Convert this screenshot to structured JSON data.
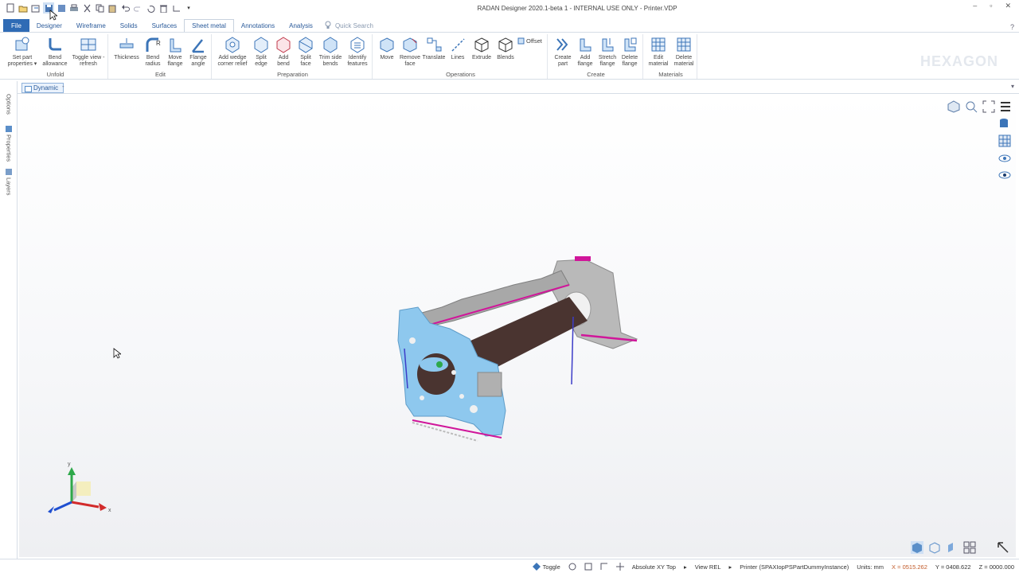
{
  "window": {
    "title": "RADAN Designer 2020.1-beta 1 - INTERNAL USE ONLY - Printer.VDP",
    "logo_text": "HEXAGON"
  },
  "tabs": [
    {
      "label": "File"
    },
    {
      "label": "Designer"
    },
    {
      "label": "Wireframe"
    },
    {
      "label": "Solids"
    },
    {
      "label": "Surfaces"
    },
    {
      "label": "Sheet metal"
    },
    {
      "label": "Annotations"
    },
    {
      "label": "Analysis"
    }
  ],
  "quick_search": {
    "label": "Quick Search"
  },
  "ribbon": {
    "unfold": {
      "label": "Unfold",
      "buttons": [
        {
          "label": "Set part properties ▾"
        },
        {
          "label": "Bend allowance"
        },
        {
          "label": "Toggle view - refresh"
        }
      ]
    },
    "edit": {
      "label": "Edit",
      "buttons": [
        {
          "label": "Thickness"
        },
        {
          "label": "Bend radius"
        },
        {
          "label": "Move flange"
        },
        {
          "label": "Flange angle"
        }
      ]
    },
    "preparation": {
      "label": "Preparation",
      "buttons": [
        {
          "label": "Add wedge corner relief"
        },
        {
          "label": "Split edge"
        },
        {
          "label": "Add bend"
        },
        {
          "label": "Split face"
        },
        {
          "label": "Trim side bends"
        },
        {
          "label": "Identify features"
        }
      ]
    },
    "operations": {
      "label": "Operations",
      "buttons": [
        {
          "label": "Move"
        },
        {
          "label": "Remove face"
        },
        {
          "label": "Translate"
        },
        {
          "label": "Lines"
        },
        {
          "label": "Extrude"
        },
        {
          "label": "Blends"
        }
      ],
      "offset_label": "Offset"
    },
    "create": {
      "label": "Create",
      "buttons": [
        {
          "label": "Create part"
        },
        {
          "label": "Add flange"
        },
        {
          "label": "Stretch flange"
        },
        {
          "label": "Delete flange"
        }
      ]
    },
    "materials": {
      "label": "Materials",
      "buttons": [
        {
          "label": "Edit material"
        },
        {
          "label": "Delete material"
        }
      ]
    }
  },
  "doc_tab": {
    "label": "Dynamic"
  },
  "side_tabs": [
    {
      "label": "Options"
    },
    {
      "label": "Properties"
    },
    {
      "label": "Layers"
    }
  ],
  "axes": {
    "x": "x",
    "y": "y"
  },
  "status": {
    "toggle": "Toggle",
    "view_mode": "Absolute XY Top",
    "view_rel": "View REL",
    "instance": "Printer (SPAXIopPSPartDummyInstance)",
    "units": "Units: mm",
    "x": "X = 0515.262",
    "y": "Y = 0408.622",
    "z": "Z = 0000.000"
  },
  "colors": {
    "accent": "#2f6bb5",
    "part_blue": "#8ec8ee",
    "part_gray": "#b8b8b8",
    "edge_magenta": "#d0169a",
    "inner_brown": "#4a3430"
  }
}
